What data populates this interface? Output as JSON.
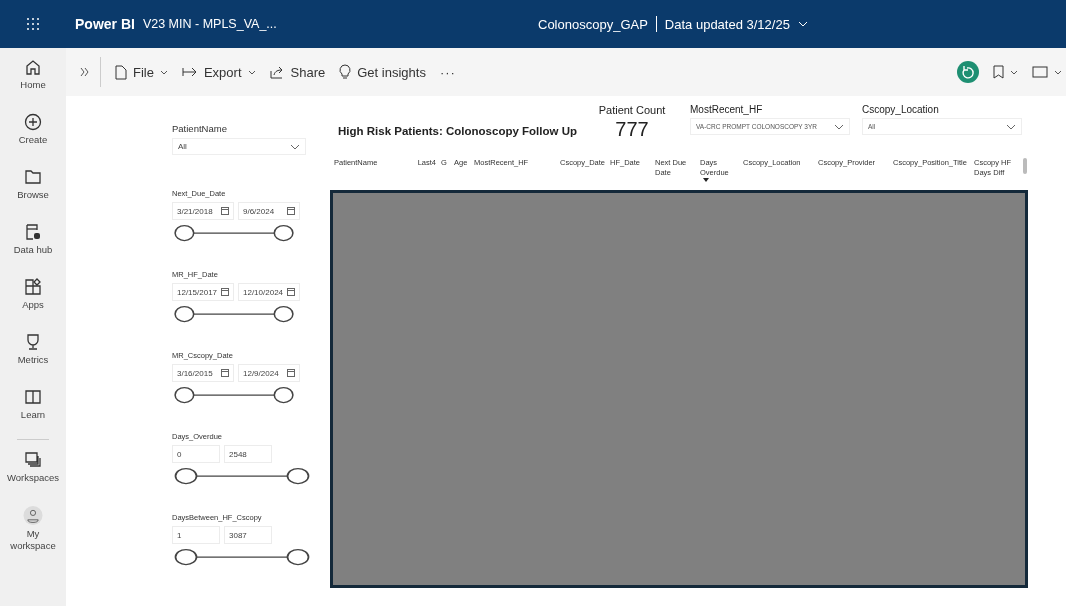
{
  "header": {
    "app_name": "Power BI",
    "workspace": "V23 MIN - MPLS_VA_...",
    "report": "Colonoscopy_GAP",
    "updated": "Data updated 3/12/25"
  },
  "nav": [
    {
      "kind": "home",
      "label": "Home"
    },
    {
      "kind": "create",
      "label": "Create"
    },
    {
      "kind": "browse",
      "label": "Browse"
    },
    {
      "kind": "datahub",
      "label": "Data hub"
    },
    {
      "kind": "apps",
      "label": "Apps"
    },
    {
      "kind": "metrics",
      "label": "Metrics"
    },
    {
      "kind": "learn",
      "label": "Learn"
    },
    {
      "kind": "workspaces",
      "label": "Workspaces"
    },
    {
      "kind": "profile",
      "label": "My workspace"
    }
  ],
  "toolbar": [
    {
      "kind": "file",
      "label": "File",
      "dropdown": true
    },
    {
      "kind": "export",
      "label": "Export",
      "dropdown": true
    },
    {
      "kind": "share",
      "label": "Share",
      "dropdown": false
    },
    {
      "kind": "insights",
      "label": "Get insights",
      "dropdown": false
    },
    {
      "kind": "more",
      "label": "···",
      "dropdown": false
    }
  ],
  "filters": [
    {
      "kind": "dropdown",
      "label": "PatientName",
      "value": "All"
    },
    {
      "kind": "date",
      "label": "Next_Due_Date",
      "from": "3/21/2018",
      "to": "9/6/2024",
      "thumbs": [
        {
          "level": 0
        },
        {
          "level": 1
        }
      ]
    },
    {
      "kind": "date",
      "label": "MR_HF_Date",
      "from": "12/15/2017",
      "to": "12/10/2024",
      "thumbs": [
        {
          "level": 0
        },
        {
          "level": 1
        }
      ]
    },
    {
      "kind": "date",
      "label": "MR_Cscopy_Date",
      "from": "3/16/2015",
      "to": "12/9/2024",
      "thumbs": [
        {
          "level": 0
        },
        {
          "level": 1
        }
      ]
    },
    {
      "kind": "number",
      "label": "Days_Overdue",
      "from": "0",
      "to": "2548",
      "thumbs": [
        {
          "level": 0
        },
        {
          "level": 1
        }
      ]
    },
    {
      "kind": "number",
      "label": "DaysBetween_HF_Cscopy",
      "from": "1",
      "to": "3087",
      "thumbs": [
        {
          "level": 0
        },
        {
          "level": 1
        }
      ]
    }
  ],
  "report": {
    "title": "High Risk Patients: Colonoscopy Follow Up",
    "count_label": "Patient Count",
    "count": "777",
    "slicers": [
      {
        "label": "MostRecent_HF",
        "value": "VA-CRC PROMPT COLONOSCOPY 3YR"
      },
      {
        "label": "Cscopy_Location",
        "value": "All"
      }
    ]
  },
  "table": {
    "columns": [
      {
        "label": "PatientName",
        "sorted": false
      },
      {
        "label": "Last4",
        "sorted": false
      },
      {
        "label": "G",
        "sorted": false
      },
      {
        "label": "Age",
        "sorted": false
      },
      {
        "label": "MostRecent_HF",
        "sorted": false
      },
      {
        "label": "Cscopy_Date",
        "sorted": false
      },
      {
        "label": "HF_Date",
        "sorted": false
      },
      {
        "label": "Next Due Date",
        "sorted": false
      },
      {
        "label": "Days Overdue",
        "sorted": true
      },
      {
        "label": "Cscopy_Location",
        "sorted": false
      },
      {
        "label": "Cscopy_Provider",
        "sorted": false
      },
      {
        "label": "Cscopy_Position_Title",
        "sorted": false
      },
      {
        "label": "Cscopy HF Days Diff",
        "sorted": false
      }
    ]
  }
}
